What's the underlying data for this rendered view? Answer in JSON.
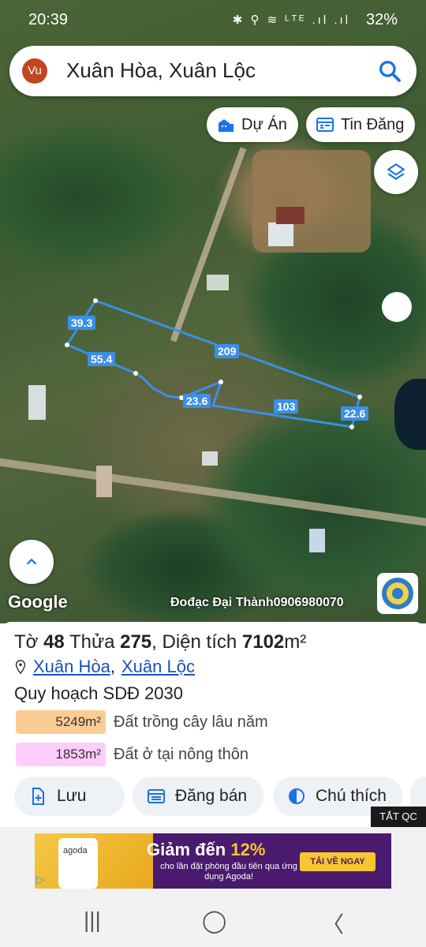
{
  "status_bar": {
    "time": "20:39",
    "icons": "✱ ⚲ ≋ ᴸᵀᴱ .ıl .ıl",
    "battery": "32%"
  },
  "search": {
    "avatar_initials": "Vu",
    "query": "Xuân Hòa, Xuân Lộc"
  },
  "chips": {
    "projects": "Dự Án",
    "listings": "Tin Đăng"
  },
  "map": {
    "parcel_labels": [
      "39.3",
      "55.4",
      "209",
      "23.6",
      "103",
      "22.6"
    ],
    "google_logo": "Google",
    "credit": "Đođạc Đại Thành0906980070"
  },
  "parcel": {
    "sheet_label": "Tờ",
    "sheet_no": "48",
    "plot_label": "Thửa",
    "plot_no": "275",
    "area_label": ", Diện tích",
    "area_value": "7102",
    "area_unit": "m²",
    "commune": "Xuân Hòa",
    "district": "Xuân Lộc",
    "separator": ",",
    "plan_title": "Quy hoạch SDĐ 2030",
    "zones": [
      {
        "area": "5249m²",
        "label": "Đất trồng cây lâu năm",
        "color": "#fdcc95"
      },
      {
        "area": "1853m²",
        "label": "Đất ở tại nông thôn",
        "color": "#fdcdfc"
      }
    ]
  },
  "actions": {
    "save": "Lưu",
    "post": "Đăng bán",
    "legend": "Chú thích"
  },
  "ad": {
    "close": "TẮT QC",
    "brand": "agoda",
    "headline_a": "Giảm đến ",
    "headline_b": "12%",
    "sub": "cho lần đặt phòng đầu tiên qua ứng dụng Agoda!",
    "cta": "TẢI VỀ NGAY"
  },
  "nav": {
    "recent": "|||",
    "home": "◯",
    "back": "〈"
  }
}
